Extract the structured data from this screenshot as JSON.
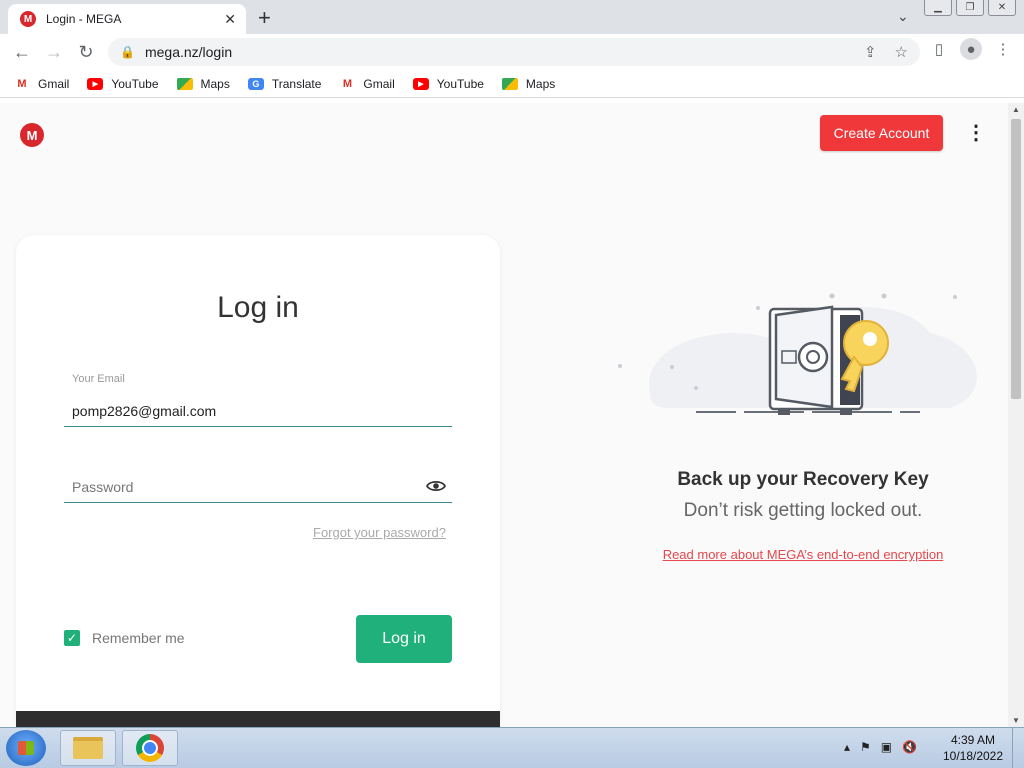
{
  "browser": {
    "tab_title": "Login - MEGA",
    "url": "mega.nz/login",
    "bookmarks": [
      {
        "label": "Gmail",
        "icon": "gmail-icon"
      },
      {
        "label": "YouTube",
        "icon": "youtube-icon"
      },
      {
        "label": "Maps",
        "icon": "maps-icon"
      },
      {
        "label": "Translate",
        "icon": "translate-icon"
      },
      {
        "label": "Gmail",
        "icon": "gmail-icon"
      },
      {
        "label": "YouTube",
        "icon": "youtube-icon"
      },
      {
        "label": "Maps",
        "icon": "maps-icon"
      }
    ]
  },
  "header": {
    "create_account": "Create Account"
  },
  "login": {
    "title": "Log in",
    "email_label": "Your Email",
    "email_value": "pomp2826@gmail.com",
    "password_placeholder": "Password",
    "forgot": "Forgot your password?",
    "remember": "Remember me",
    "remember_checked": true,
    "submit": "Log in"
  },
  "promo": {
    "title": "Back up your Recovery Key",
    "subtitle": "Don’t risk getting locked out.",
    "link": "Read more about MEGA’s end-to-end encryption"
  },
  "taskbar": {
    "time": "4:39 AM",
    "date": "10/18/2022"
  },
  "colors": {
    "brand_red": "#d9272e",
    "create_button": "#f0373a",
    "login_button": "#1fb07c",
    "link_red": "#e5484d"
  }
}
